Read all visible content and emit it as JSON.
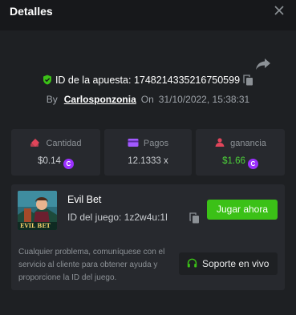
{
  "header": {
    "title": "Detalles"
  },
  "bet": {
    "id_label": "ID de la apuesta:",
    "id_value": "1748214335216750599",
    "by_label": "By",
    "username": "Carlosponzonia",
    "on_label": "On",
    "date": "31/10/2022, 15:38:31"
  },
  "stats": [
    {
      "label": "Cantidad",
      "value": "$0.14",
      "icon": "money-icon",
      "coin": "C"
    },
    {
      "label": "Pagos",
      "value": "12.1333 x",
      "icon": "wallet-icon"
    },
    {
      "label": "ganancia",
      "value": "$1.66",
      "icon": "profit-icon",
      "coin": "C"
    }
  ],
  "game": {
    "name": "Evil Bet",
    "id_text": "ID del juego: 1z2w4u:1l",
    "thumbnail_text": "EVIL BET",
    "play_label": "Jugar ahora",
    "help_text": "Cualquier problema, comuníquese con el servicio al cliente para obtener ayuda y proporcione la ID del juego.",
    "support_label": "Soporte en vivo"
  },
  "colors": {
    "accent_green": "#3bc117",
    "profit_green": "#4dd13a",
    "coin_purple": "#9b30ff",
    "stat_icon_red": "#e0455a",
    "stat_icon_purple": "#a259ff"
  }
}
